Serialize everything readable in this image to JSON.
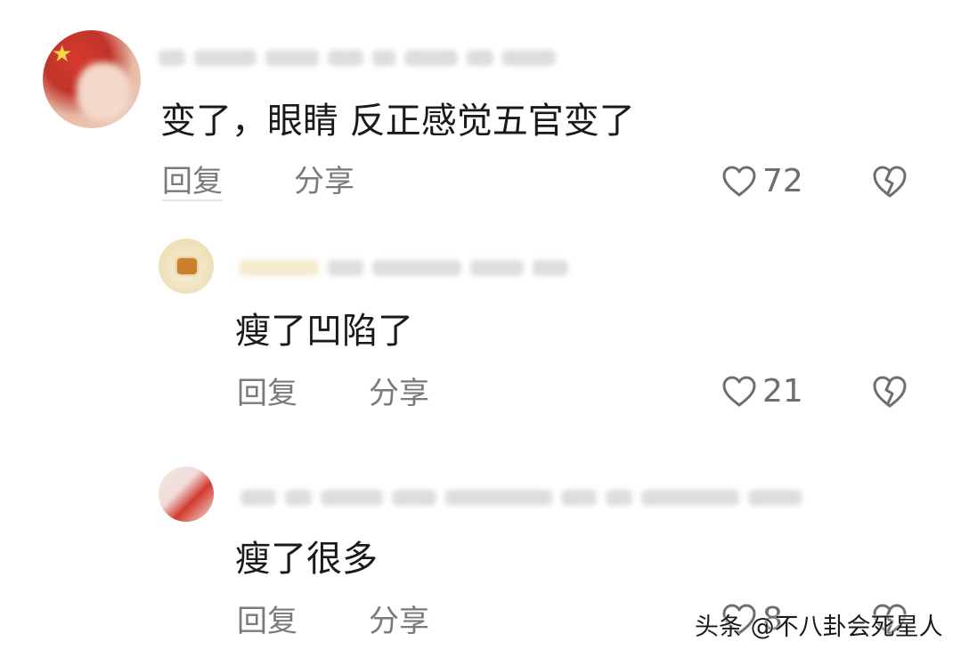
{
  "comments": [
    {
      "text": "变了，眼睛 反正感觉五官变了",
      "reply_label": "回复",
      "share_label": "分享",
      "like_count": "72"
    },
    {
      "text": "瘦了凹陷了",
      "reply_label": "回复",
      "share_label": "分享",
      "like_count": "21"
    },
    {
      "text": "瘦了很多",
      "reply_label": "回复",
      "share_label": "分享",
      "like_count": "8"
    }
  ],
  "icons": {
    "like": "heart-outline-icon",
    "dislike": "broken-heart-icon"
  },
  "watermark": "头条 @不八卦会死星人",
  "colors": {
    "text": "#1a1a1a",
    "muted": "#7a7a7a",
    "icon": "#6e6e6e"
  }
}
